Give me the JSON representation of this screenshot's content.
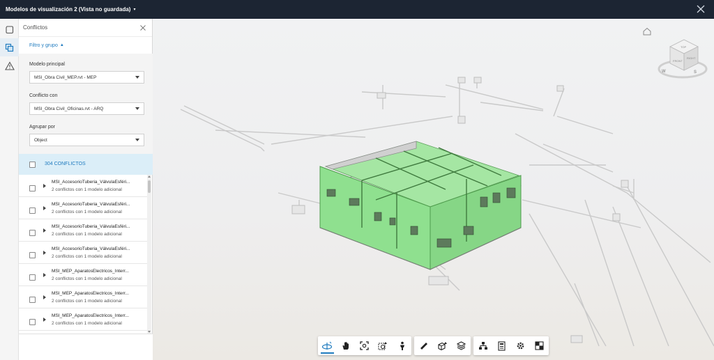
{
  "window": {
    "title": "Modelos de visualización 2 (Vista no guardada)",
    "close_icon": "close-icon"
  },
  "rail": {
    "items": [
      {
        "icon": "model-browser-icon",
        "active": false
      },
      {
        "icon": "conflicts-icon",
        "active": true
      },
      {
        "icon": "warning-icon",
        "active": false
      }
    ]
  },
  "panel": {
    "title": "Conflictos",
    "filter_toggle": "Filtro y grupo",
    "main_model_label": "Modelo principal",
    "main_model_value": "MSI_Obra Civil_MEP.rvt - MEP",
    "conflict_with_label": "Conflicto con",
    "conflict_with_value": "MSI_Obra Civil_Oficinas.rvt - ARQ",
    "group_by_label": "Agrupar por",
    "group_by_value": "Object",
    "conflicts_header": "304 CONFLICTOS",
    "items": [
      {
        "name": "MSI_AccesorioTuberia_VálvulaEsféri...",
        "sub": "2 conflictos con 1 modelo adicional"
      },
      {
        "name": "MSI_AccesorioTuberia_VálvulaEsféri...",
        "sub": "2 conflictos con 1 modelo adicional"
      },
      {
        "name": "MSI_AccesorioTuberia_VálvulaEsféri...",
        "sub": "2 conflictos con 1 modelo adicional"
      },
      {
        "name": "MSI_AccesorioTuberia_VálvulaEsféri...",
        "sub": "2 conflictos con 1 modelo adicional"
      },
      {
        "name": "MSI_MEP_AparatosElectricos_Interr...",
        "sub": "2 conflictos con 1 modelo adicional"
      },
      {
        "name": "MSI_MEP_AparatosElectricos_Interr...",
        "sub": "2 conflictos con 1 modelo adicional"
      },
      {
        "name": "MSI_MEP_AparatosElectricos_Interr...",
        "sub": "2 conflictos con 1 modelo adicional"
      }
    ]
  },
  "viewcube": {
    "faces": [
      "FRONT",
      "RIGHT",
      "TOP"
    ],
    "compass": [
      "W",
      "S"
    ]
  },
  "toolbar": {
    "groups": [
      [
        "orbit-icon",
        "pan-icon",
        "fit-view-icon",
        "zoom-window-icon",
        "first-person-icon"
      ],
      [
        "measure-icon",
        "section-icon",
        "layers-icon"
      ],
      [
        "model-browser-icon",
        "properties-icon",
        "settings-icon",
        "fullscreen-icon"
      ]
    ],
    "active": "orbit-icon"
  },
  "colors": {
    "titlebar": "#1c2533",
    "accent": "#1f7bbf",
    "conflict_green": "#8fe08f",
    "selected_header": "#dbeef8"
  }
}
